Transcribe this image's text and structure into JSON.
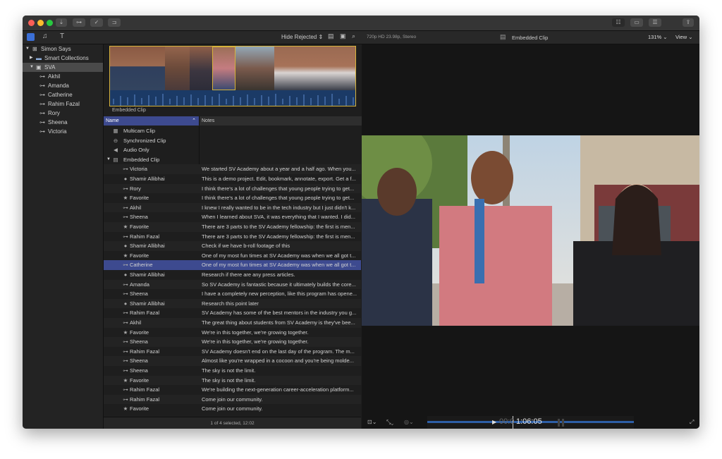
{
  "window": {
    "toolbar_icons": [
      "import-icon",
      "keyword-icon",
      "check-icon",
      "tag-icon",
      "workspace-icon",
      "timeline-icon",
      "inspector-icon",
      "share-icon"
    ]
  },
  "browser_toolbar": {
    "filter_label": "Hide Rejected",
    "icons": [
      "libraries-icon",
      "photos-icon",
      "titles-icon",
      "clip-appearance-icon",
      "filmstrip-icon",
      "search-icon"
    ]
  },
  "sidebar": {
    "library": "Simon Says",
    "smart_collections": "Smart Collections",
    "event": "SVA",
    "keywords": [
      "Akhil",
      "Amanda",
      "Catherine",
      "Rahim Fazal",
      "Rory",
      "Sheena",
      "Victoria"
    ]
  },
  "filmstrip": {
    "label": "Embedded Clip"
  },
  "list": {
    "col_name": "Name",
    "col_notes": "Notes",
    "clips": [
      {
        "icon": "multicam-icon",
        "glyph": "▦",
        "name": "Multicam Clip",
        "note": ""
      },
      {
        "icon": "sync-icon",
        "glyph": "⊖",
        "name": "Synchronized Clip",
        "note": ""
      },
      {
        "icon": "audio-icon",
        "glyph": "◀",
        "name": "Audio Only",
        "note": ""
      },
      {
        "icon": "embedded-clip-icon",
        "glyph": "▤",
        "name": "Embedded Clip",
        "note": ""
      }
    ],
    "rows": [
      {
        "icon": "keyword-icon",
        "glyph": "⊶",
        "name": "Victoria",
        "note": "We started SV Academy about a year and a half ago. When you..."
      },
      {
        "icon": "marker-icon",
        "glyph": "●",
        "name": "Shamir Allibhai",
        "note": "This is a demo project. Edit, bookmark, annotate, export. Get a f..."
      },
      {
        "icon": "keyword-icon",
        "glyph": "⊶",
        "name": "Rory",
        "note": "I think there's a lot of challenges that young people trying to get..."
      },
      {
        "icon": "favorite-icon",
        "glyph": "★",
        "name": "Favorite",
        "note": "I think there's a lot of challenges that young people trying to get..."
      },
      {
        "icon": "keyword-icon",
        "glyph": "⊶",
        "name": "Akhil",
        "note": "I knew I really wanted to be in the tech industry but I just didn't k..."
      },
      {
        "icon": "keyword-icon",
        "glyph": "⊶",
        "name": "Sheena",
        "note": "When I learned about SVA, it was everything that I wanted. I did..."
      },
      {
        "icon": "favorite-icon",
        "glyph": "★",
        "name": "Favorite",
        "note": "There are 3 parts to the SV Academy fellowship: the first is men..."
      },
      {
        "icon": "keyword-icon",
        "glyph": "⊶",
        "name": "Rahim Fazal",
        "note": "There are 3 parts to the SV Academy fellowship: the first is men..."
      },
      {
        "icon": "marker-icon",
        "glyph": "●",
        "name": "Shamir Allibhai",
        "note": "Check if we have b-roll footage of this"
      },
      {
        "icon": "favorite-icon",
        "glyph": "★",
        "name": "Favorite",
        "note": "One of my most fun times at SV Academy was when we all got t..."
      },
      {
        "icon": "keyword-icon",
        "glyph": "⊶",
        "name": "Catherine",
        "note": "One of my most fun times at SV Academy was when we all got t...",
        "selected": true
      },
      {
        "icon": "marker-icon",
        "glyph": "●",
        "name": "Shamir Allibhai",
        "note": "Research if there are any press articles."
      },
      {
        "icon": "keyword-icon",
        "glyph": "⊶",
        "name": "Amanda",
        "note": "So SV Academy is fantastic because it ultimately builds the core..."
      },
      {
        "icon": "keyword-icon",
        "glyph": "⊶",
        "name": "Sheena",
        "note": "I have a completely new perception, like this program has opene..."
      },
      {
        "icon": "marker-icon",
        "glyph": "●",
        "name": "Shamir Allibhai",
        "note": "Research this point later"
      },
      {
        "icon": "keyword-icon",
        "glyph": "⊶",
        "name": "Rahim Fazal",
        "note": "SV Academy has some of the best mentors in the industry you g..."
      },
      {
        "icon": "keyword-icon",
        "glyph": "⊶",
        "name": "Akhil",
        "note": "The great thing about students from SV Academy is they've bee..."
      },
      {
        "icon": "favorite-icon",
        "glyph": "★",
        "name": "Favorite",
        "note": "We're in this together, we're growing together."
      },
      {
        "icon": "keyword-icon",
        "glyph": "⊶",
        "name": "Sheena",
        "note": "We're in this together, we're growing together."
      },
      {
        "icon": "keyword-icon",
        "glyph": "⊶",
        "name": "Rahim Fazal",
        "note": "SV Academy doesn't end on the last day of the program. The m..."
      },
      {
        "icon": "keyword-icon",
        "glyph": "⊶",
        "name": "Sheena",
        "note": "Almost like you're wrapped in a cocoon and you're being molde..."
      },
      {
        "icon": "keyword-icon",
        "glyph": "⊶",
        "name": "Sheena",
        "note": "The sky is not the limit."
      },
      {
        "icon": "favorite-icon",
        "glyph": "★",
        "name": "Favorite",
        "note": "The sky is not the limit."
      },
      {
        "icon": "keyword-icon",
        "glyph": "⊶",
        "name": "Rahim Fazal",
        "note": "We're building the next-generation career-acceleration platform..."
      },
      {
        "icon": "keyword-icon",
        "glyph": "⊶",
        "name": "Rahim Fazal",
        "note": "Come join our community."
      },
      {
        "icon": "favorite-icon",
        "glyph": "★",
        "name": "Favorite",
        "note": "Come join our community."
      }
    ],
    "status": "1 of 4 selected, 12:02"
  },
  "viewer": {
    "format": "720p HD 23.98p, Stereo",
    "clip_name": "Embedded Clip",
    "zoom": "131%",
    "view_label": "View",
    "timecode_dim": "00:0",
    "timecode": "1:06:05"
  },
  "colors": {
    "accent_blue": "#4a5db8",
    "selection": "#3d4a8f",
    "filmstrip_border": "#d6b23a",
    "waveform": "#2d5ea6"
  }
}
